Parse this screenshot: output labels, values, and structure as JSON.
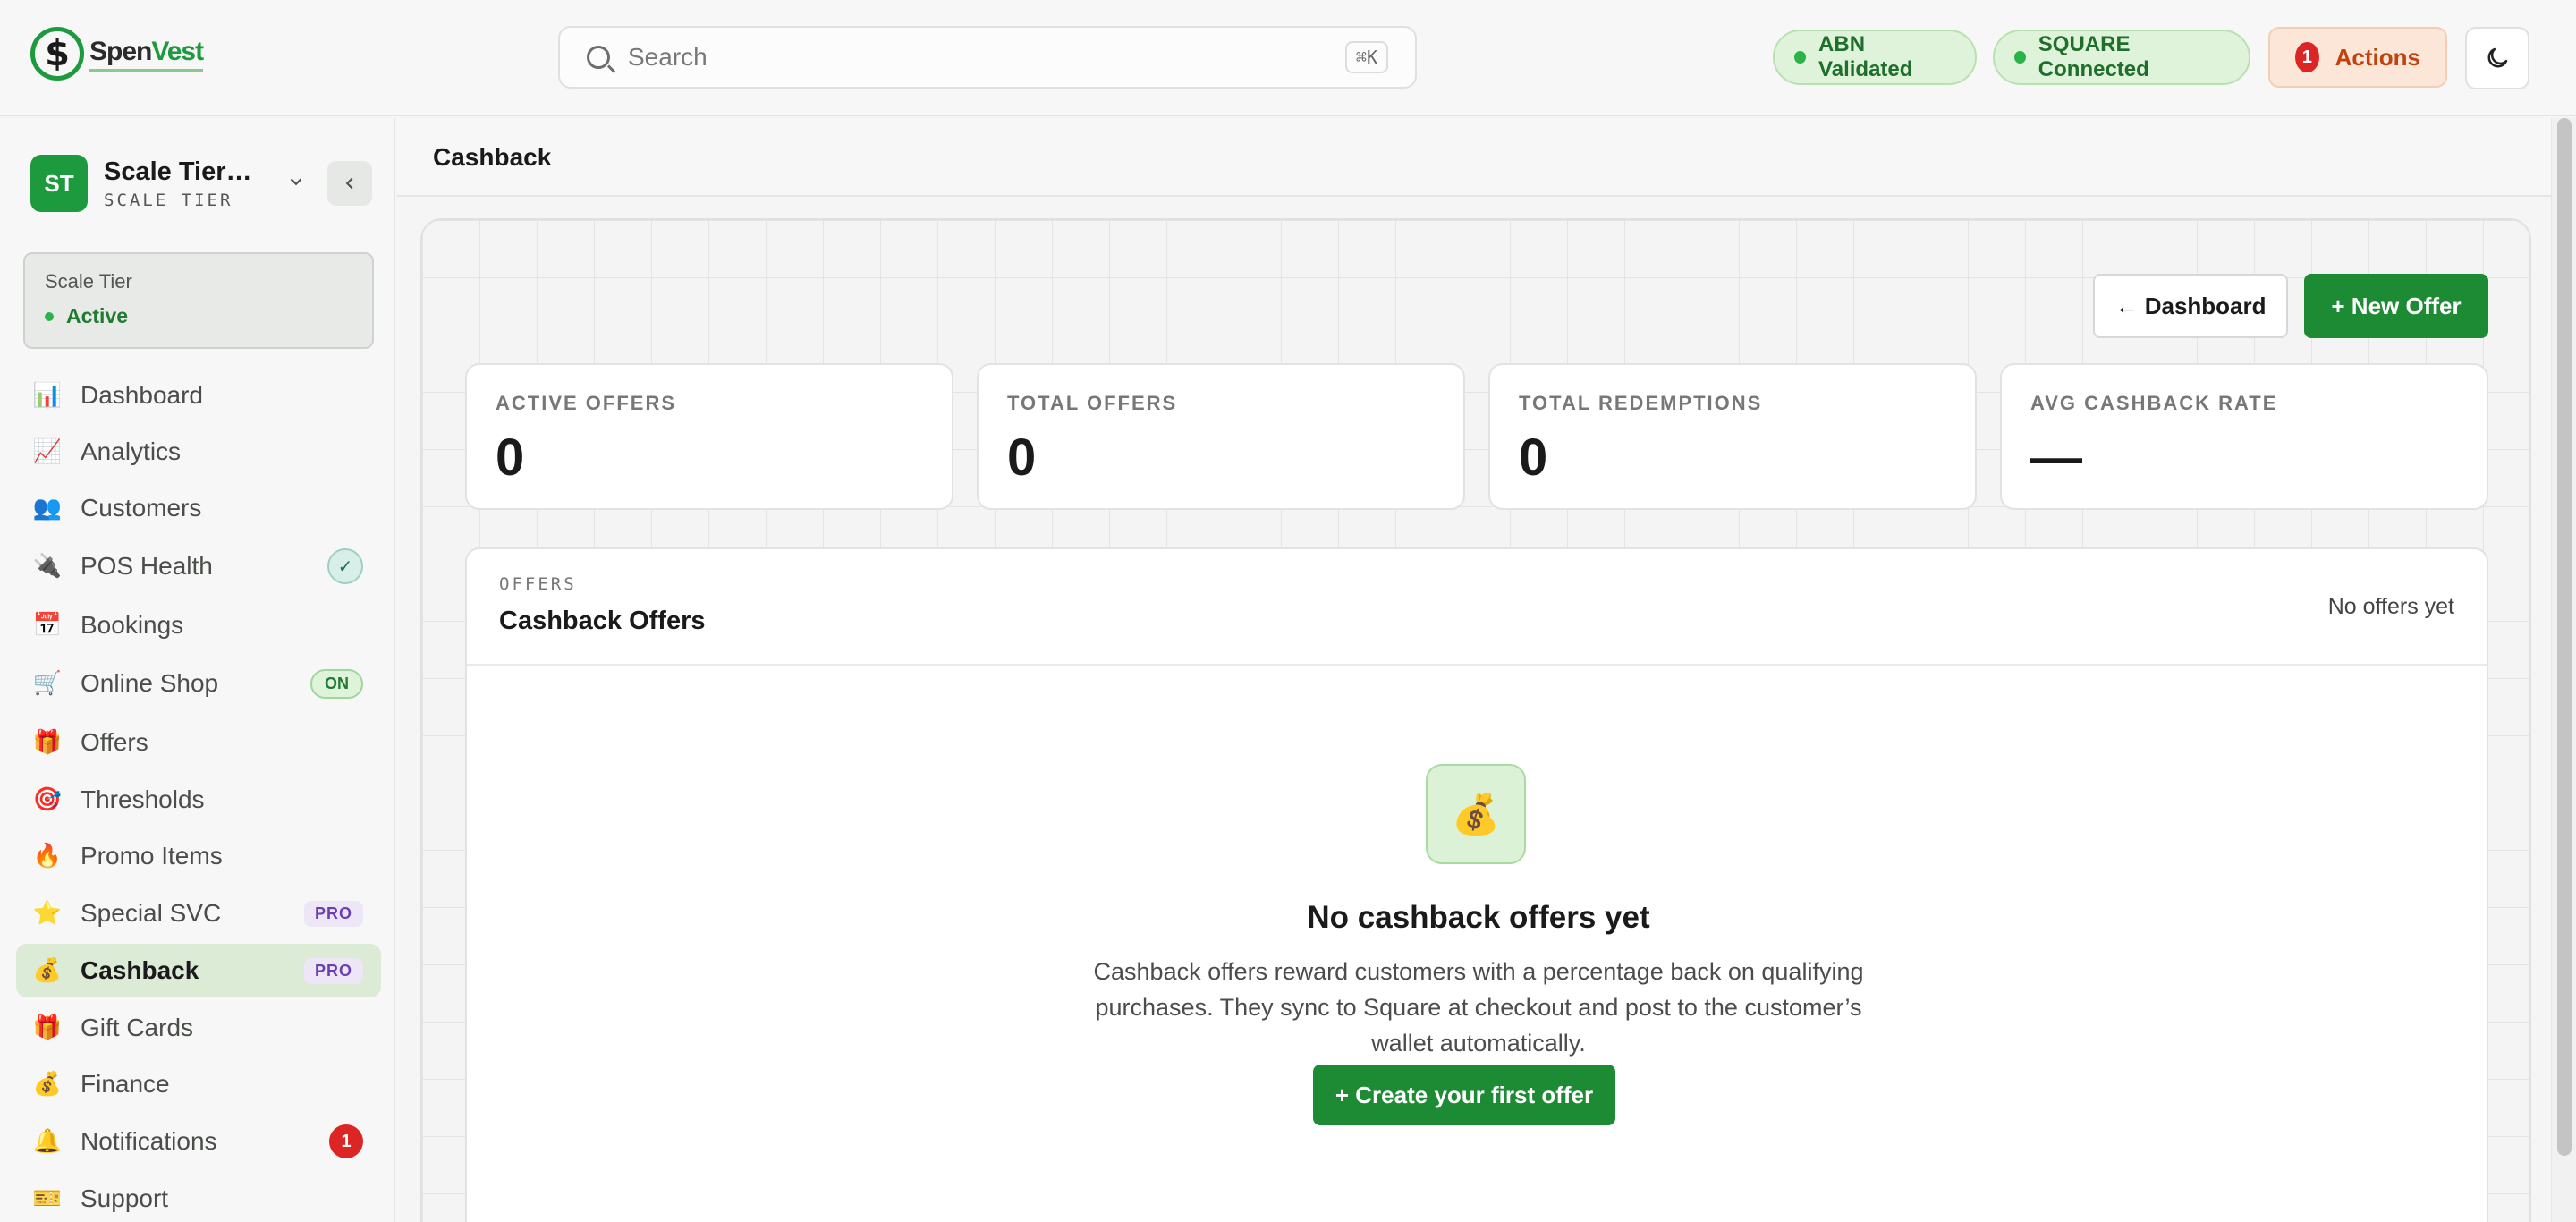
{
  "brand": {
    "logo_symbol": "$",
    "name_a": "Spen",
    "name_b": "Vest",
    "accent": "#1d9a3d"
  },
  "search": {
    "placeholder": "Search",
    "shortcut": "⌘K"
  },
  "status": {
    "abn": "ABN Validated",
    "square": "SQUARE Connected"
  },
  "actions": {
    "label": "Actions",
    "count": "1"
  },
  "theme_toggle": {
    "icon": "moon-icon"
  },
  "org": {
    "initials": "ST",
    "name": "Scale Tier Demo",
    "tier": "SCALE TIER"
  },
  "tier_card": {
    "name": "Scale Tier",
    "status": "Active"
  },
  "nav": [
    {
      "label": "Dashboard",
      "icon": "📊"
    },
    {
      "label": "Analytics",
      "icon": "📈"
    },
    {
      "label": "Customers",
      "icon": "👥"
    },
    {
      "label": "POS Health",
      "icon": "🔌",
      "badge": "✓"
    },
    {
      "label": "Bookings",
      "icon": "📅"
    },
    {
      "label": "Online Shop",
      "icon": "🛒",
      "badge": "ON"
    },
    {
      "label": "Offers",
      "icon": "🎁"
    },
    {
      "label": "Thresholds",
      "icon": "🎯"
    },
    {
      "label": "Promo Items",
      "icon": "🔥"
    },
    {
      "label": "Special SVC",
      "icon": "⭐",
      "badge": "PRO"
    },
    {
      "label": "Cashback",
      "icon": "💰",
      "badge": "PRO"
    },
    {
      "label": "Gift Cards",
      "icon": "🎁"
    },
    {
      "label": "Finance",
      "icon": "💰"
    },
    {
      "label": "Notifications",
      "icon": "🔔",
      "badge": "1"
    },
    {
      "label": "Support",
      "icon": "🎫"
    }
  ],
  "page": {
    "title": "Cashback",
    "back_label": "← Dashboard",
    "new_label": "+ New Offer"
  },
  "stats": [
    {
      "label": "ACTIVE OFFERS",
      "value": "0"
    },
    {
      "label": "TOTAL OFFERS",
      "value": "0"
    },
    {
      "label": "TOTAL REDEMPTIONS",
      "value": "0"
    },
    {
      "label": "AVG CASHBACK RATE",
      "value": "—"
    }
  ],
  "offers": {
    "kicker": "OFFERS",
    "title": "Cashback Offers",
    "count_text": "No offers yet",
    "empty_icon": "💰",
    "empty_title": "No cashback offers yet",
    "empty_desc": "Cashback offers reward customers with a percentage back on qualifying purchases. They sync to Square at checkout and post to the customer’s wallet automatically.",
    "create_label": "+ Create your first offer"
  }
}
